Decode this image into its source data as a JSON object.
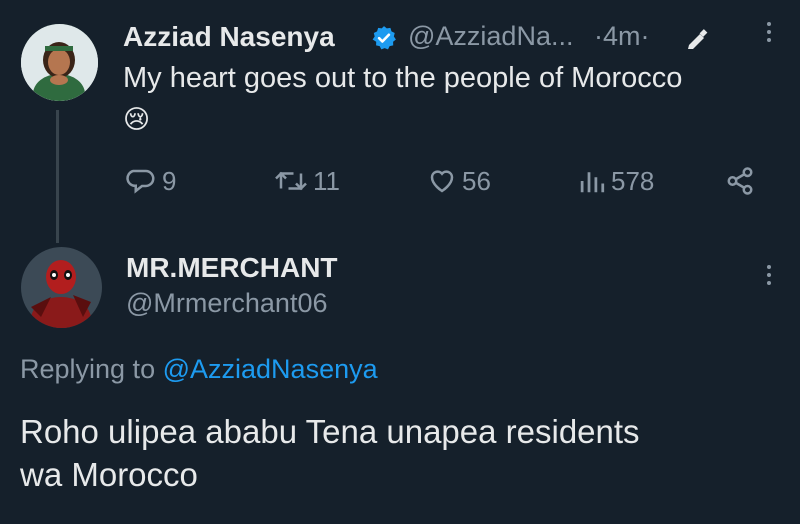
{
  "tweet": {
    "author_name": "Azziad Nasenya",
    "handle": "@AzziadNa...",
    "time": "·4m·",
    "text": "My heart goes out to the people of Morocco",
    "emoji": "😢",
    "verified_color": "#1d9bf0",
    "actions": {
      "replies": "9",
      "retweets": "11",
      "likes": "56",
      "views": "578"
    }
  },
  "reply": {
    "author_name": "MR.MERCHANT",
    "handle": "@Mrmerchant06",
    "replying_prefix": "Replying to",
    "replying_to": "@AzziadNasenya",
    "text_line1": "Roho ulipea ababu Tena unapea residents",
    "text_line2": "wa Morocco"
  },
  "colors": {
    "background": "#15202b",
    "text": "#e7e9ea",
    "muted": "#8b98a5",
    "link": "#1d9bf0"
  }
}
